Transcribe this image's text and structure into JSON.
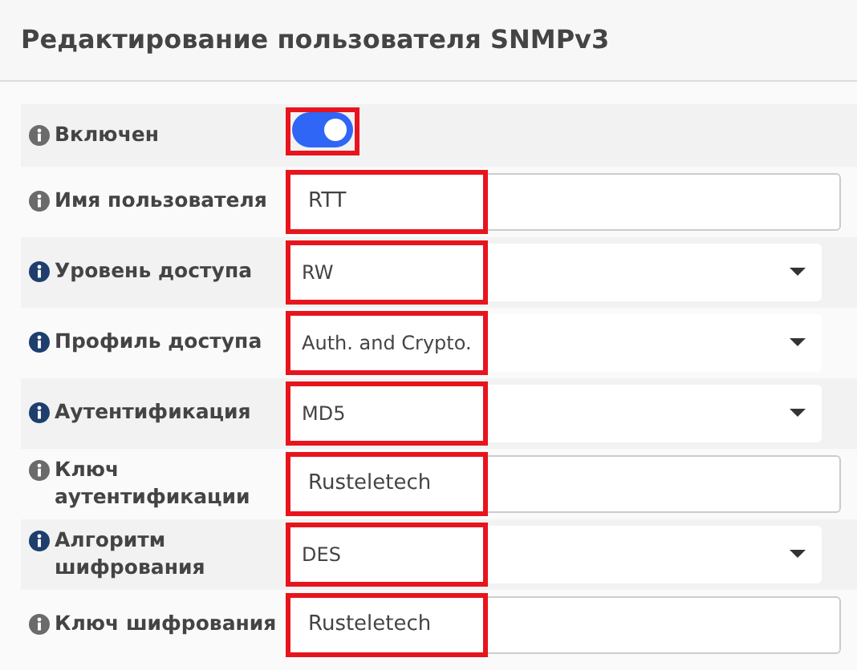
{
  "title": "Редактирование пользователя SNMPv3",
  "fields": [
    {
      "kind": "switch",
      "label": "Включен",
      "on": true,
      "highlighted": true
    },
    {
      "kind": "text",
      "label": "Имя пользователя",
      "value": "RTT",
      "highlighted": true
    },
    {
      "kind": "select",
      "label": "Уровень доступа",
      "value": "RW",
      "highlighted": true
    },
    {
      "kind": "select",
      "label": "Профиль доступа",
      "value": "Auth. and Crypto.",
      "highlighted": true
    },
    {
      "kind": "select",
      "label": "Аутентификация",
      "value": "MD5",
      "highlighted": true
    },
    {
      "kind": "text",
      "label": "Ключ аутентификации",
      "value": "Rusteletech",
      "highlighted": true
    },
    {
      "kind": "select",
      "label": "Алгоритм шифрования",
      "value": "DES",
      "highlighted": true
    },
    {
      "kind": "text",
      "label": "Ключ шифрования",
      "value": "Rusteletech",
      "highlighted": true
    }
  ]
}
